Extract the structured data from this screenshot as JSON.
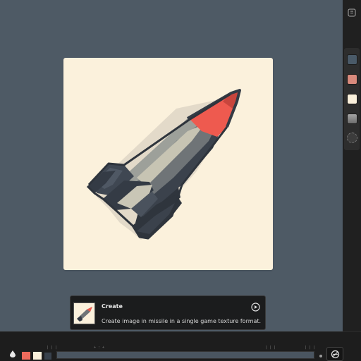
{
  "prompt": {
    "title": "Create",
    "text": "Create image in missile in a single game texture format."
  },
  "palette": {
    "panel_swatches": [
      "#4a5a68",
      "#d98a7c",
      "#fbf1dc",
      "#8e8e8e"
    ],
    "bottom_chips": [
      "#ee6a5c",
      "#fbf1dc",
      "#38414c"
    ]
  },
  "icons": {
    "top_right": "grid-icon",
    "prompt_action": "play-icon",
    "tool": "drop-icon",
    "reset": "reset-icon"
  },
  "colors": {
    "canvas_bg": "#4e5a65",
    "artboard_bg": "#fbf1dc",
    "missile_tip": "#ee5a4f",
    "missile_body": "#7d8080",
    "missile_dark": "#343b45"
  }
}
